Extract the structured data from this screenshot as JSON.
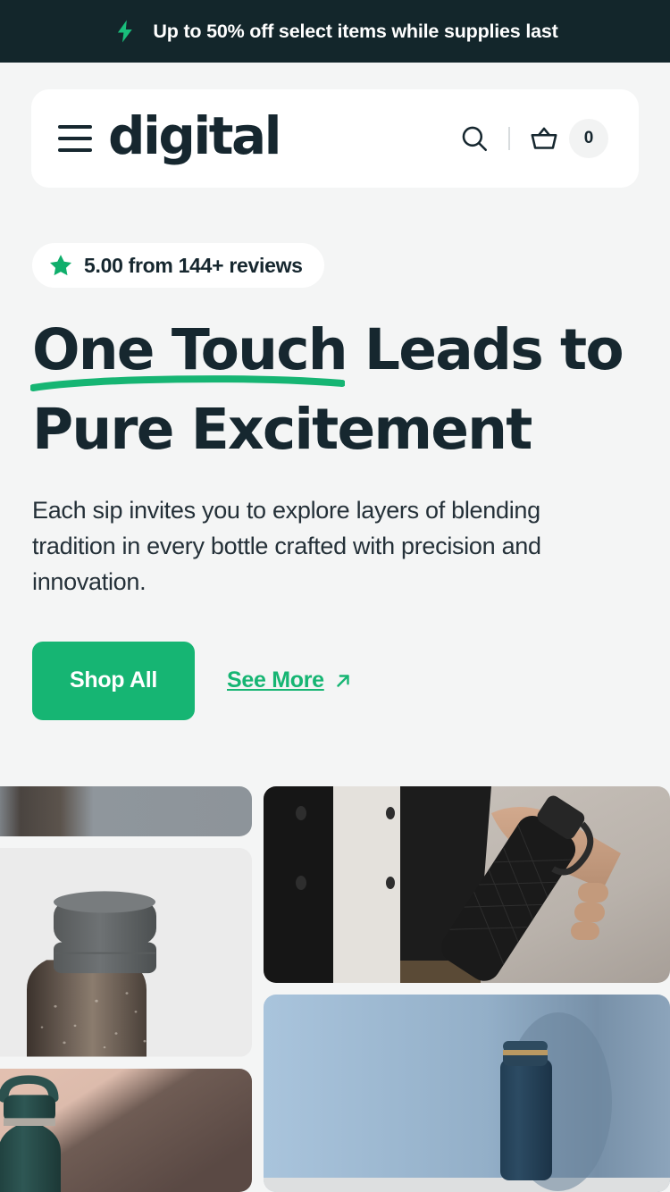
{
  "promo": {
    "icon": "lightning-bolt-icon",
    "text": "Up to 50% off select items while supplies last",
    "background_color": "#13262B",
    "icon_color": "#19BE7B"
  },
  "header": {
    "menu_icon": "hamburger-menu-icon",
    "logo": "digital",
    "search_icon": "search-icon",
    "cart_icon": "basket-icon",
    "cart_count": "0"
  },
  "hero": {
    "rating": {
      "star_icon": "star-icon",
      "text": "5.00 from 144+ reviews"
    },
    "headline_line1": "One Touch Leads to",
    "headline_line2": "Pure Excitement",
    "subtitle": "Each sip invites you to explore layers of blending tradition in every bottle crafted with precision and innovation.",
    "primary_cta": "Shop All",
    "secondary_cta": "See More",
    "secondary_cta_icon": "arrow-up-right-icon",
    "accent_color": "#16B573",
    "text_color": "#16272F"
  },
  "gallery": {
    "items": [
      {
        "name": "gallery-image-gray-bottle-top-crop",
        "alt": "Gray bottle partial crop"
      },
      {
        "name": "gallery-image-bronze-speckled-bottle",
        "alt": "Bronze speckled bottle with gray cap"
      },
      {
        "name": "gallery-image-teal-bottle-handle",
        "alt": "Teal bottle with carry handle on pink background"
      },
      {
        "name": "gallery-image-person-holding-black-bottle",
        "alt": "Person in dark jacket holding textured black bottle"
      },
      {
        "name": "gallery-image-navy-bottle-blue-wall",
        "alt": "Navy bottle with gold ring against blue wall"
      }
    ]
  }
}
